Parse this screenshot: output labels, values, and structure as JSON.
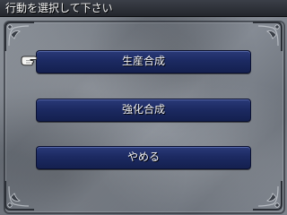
{
  "header": {
    "title": "行動を選択して下さい"
  },
  "menu": {
    "items": [
      {
        "label": "生産合成"
      },
      {
        "label": "強化合成"
      },
      {
        "label": "やめる"
      }
    ],
    "selected_index": 0
  },
  "colors": {
    "button": "#1c2a62",
    "button_highlight": "#2a3a78",
    "title_bar": "#2e3138",
    "stone": "#7d838c"
  },
  "icons": {
    "cursor": "pointing-hand-icon"
  }
}
